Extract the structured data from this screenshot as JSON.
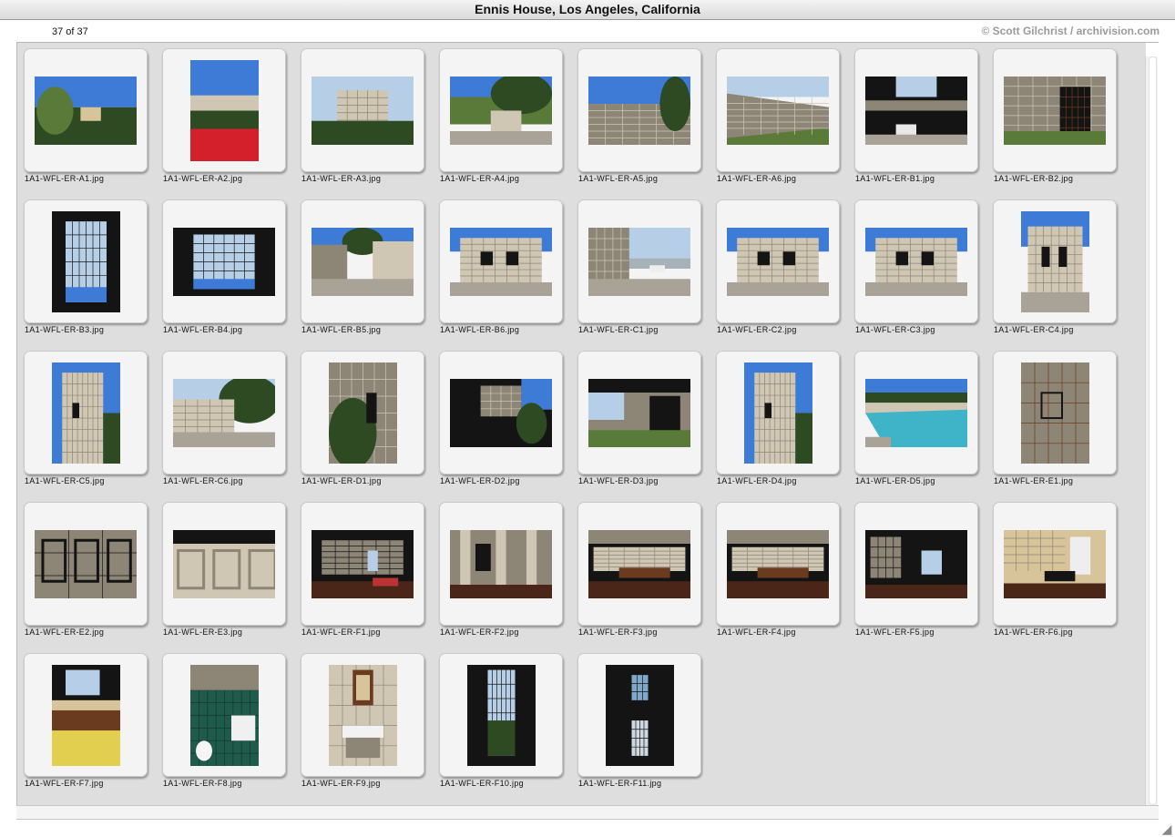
{
  "window": {
    "title": "Ennis House, Los Angeles, California"
  },
  "toolbar": {
    "count": "37 of 37",
    "copyright": "© Scott Gilchrist / archivision.com"
  },
  "thumbnails": [
    {
      "file": "1A1-WFL-ER-A1.jpg",
      "orientation": "landscape",
      "scene": "trees-sky"
    },
    {
      "file": "1A1-WFL-ER-A2.jpg",
      "orientation": "portrait",
      "scene": "flowers-house"
    },
    {
      "file": "1A1-WFL-ER-A3.jpg",
      "orientation": "landscape",
      "scene": "house-hillside"
    },
    {
      "file": "1A1-WFL-ER-A4.jpg",
      "orientation": "landscape",
      "scene": "driveway-trees"
    },
    {
      "file": "1A1-WFL-ER-A5.jpg",
      "orientation": "landscape",
      "scene": "wall-sky"
    },
    {
      "file": "1A1-WFL-ER-A6.jpg",
      "orientation": "landscape",
      "scene": "long-wall"
    },
    {
      "file": "1A1-WFL-ER-B1.jpg",
      "orientation": "landscape",
      "scene": "bridge-car"
    },
    {
      "file": "1A1-WFL-ER-B2.jpg",
      "orientation": "landscape",
      "scene": "gate-entry"
    },
    {
      "file": "1A1-WFL-ER-B3.jpg",
      "orientation": "portrait",
      "scene": "iron-gate"
    },
    {
      "file": "1A1-WFL-ER-B4.jpg",
      "orientation": "landscape",
      "scene": "iron-gate"
    },
    {
      "file": "1A1-WFL-ER-B5.jpg",
      "orientation": "landscape",
      "scene": "courtyard"
    },
    {
      "file": "1A1-WFL-ER-B6.jpg",
      "orientation": "landscape",
      "scene": "block-facade"
    },
    {
      "file": "1A1-WFL-ER-C1.jpg",
      "orientation": "landscape",
      "scene": "terrace-view"
    },
    {
      "file": "1A1-WFL-ER-C2.jpg",
      "orientation": "landscape",
      "scene": "block-facade"
    },
    {
      "file": "1A1-WFL-ER-C3.jpg",
      "orientation": "landscape",
      "scene": "block-facade"
    },
    {
      "file": "1A1-WFL-ER-C4.jpg",
      "orientation": "portrait",
      "scene": "block-facade"
    },
    {
      "file": "1A1-WFL-ER-C5.jpg",
      "orientation": "portrait",
      "scene": "tower"
    },
    {
      "file": "1A1-WFL-ER-C6.jpg",
      "orientation": "landscape",
      "scene": "garage"
    },
    {
      "file": "1A1-WFL-ER-D1.jpg",
      "orientation": "portrait",
      "scene": "plants-wall"
    },
    {
      "file": "1A1-WFL-ER-D2.jpg",
      "orientation": "landscape",
      "scene": "shadow-facade"
    },
    {
      "file": "1A1-WFL-ER-D3.jpg",
      "orientation": "landscape",
      "scene": "loggia"
    },
    {
      "file": "1A1-WFL-ER-D4.jpg",
      "orientation": "portrait",
      "scene": "tower"
    },
    {
      "file": "1A1-WFL-ER-D5.jpg",
      "orientation": "landscape",
      "scene": "pool"
    },
    {
      "file": "1A1-WFL-ER-E1.jpg",
      "orientation": "portrait",
      "scene": "block-detail"
    },
    {
      "file": "1A1-WFL-ER-E2.jpg",
      "orientation": "landscape",
      "scene": "block-pattern"
    },
    {
      "file": "1A1-WFL-ER-E3.jpg",
      "orientation": "landscape",
      "scene": "block-pattern-light"
    },
    {
      "file": "1A1-WFL-ER-F1.jpg",
      "orientation": "landscape",
      "scene": "interior-hall"
    },
    {
      "file": "1A1-WFL-ER-F2.jpg",
      "orientation": "landscape",
      "scene": "interior-columns"
    },
    {
      "file": "1A1-WFL-ER-F3.jpg",
      "orientation": "landscape",
      "scene": "dining-room"
    },
    {
      "file": "1A1-WFL-ER-F4.jpg",
      "orientation": "landscape",
      "scene": "dining-room"
    },
    {
      "file": "1A1-WFL-ER-F5.jpg",
      "orientation": "landscape",
      "scene": "interior-dark"
    },
    {
      "file": "1A1-WFL-ER-F6.jpg",
      "orientation": "landscape",
      "scene": "bedroom"
    },
    {
      "file": "1A1-WFL-ER-F7.jpg",
      "orientation": "portrait",
      "scene": "kitchen"
    },
    {
      "file": "1A1-WFL-ER-F8.jpg",
      "orientation": "portrait",
      "scene": "bathroom-green"
    },
    {
      "file": "1A1-WFL-ER-F9.jpg",
      "orientation": "portrait",
      "scene": "washroom"
    },
    {
      "file": "1A1-WFL-ER-F10.jpg",
      "orientation": "portrait",
      "scene": "window-dark"
    },
    {
      "file": "1A1-WFL-ER-F11.jpg",
      "orientation": "portrait",
      "scene": "glass-window"
    }
  ],
  "palette": {
    "sky": "#3d7bd6",
    "sky_pale": "#b7cfe6",
    "foliage": "#2d4a23",
    "foliage_light": "#5a7a3a",
    "stone": "#cfc6b4",
    "stone_shadow": "#8d8576",
    "ground": "#a9a397",
    "dark": "#141414",
    "flowers": "#d4202a",
    "wood": "#6b3b1f",
    "floor": "#4a2618",
    "water": "#3fb3c8",
    "tile_green": "#1f5a4a",
    "warm_wall": "#d8c49a",
    "yellow": "#e3cf4f",
    "glass": "#7fa7c9"
  }
}
